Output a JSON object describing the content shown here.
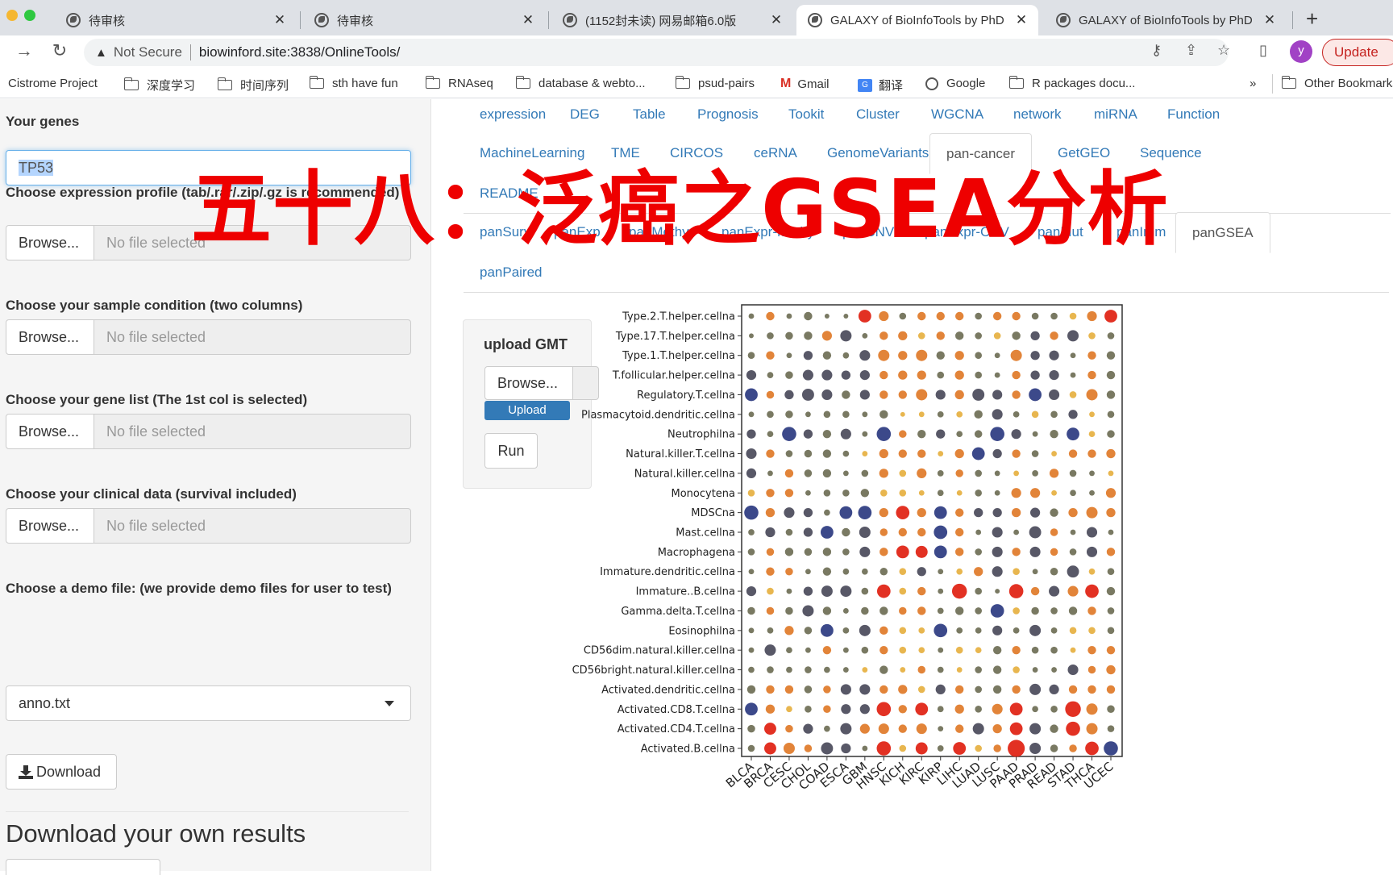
{
  "browser": {
    "tabs": [
      {
        "title": "待审核",
        "active": false
      },
      {
        "title": "待审核",
        "active": false
      },
      {
        "title": "(1152封未读) 网易邮箱6.0版",
        "active": false
      },
      {
        "title": "GALAXY of BioInfoTools by PhD",
        "active": true
      },
      {
        "title": "GALAXY of BioInfoTools by PhD",
        "active": false
      }
    ],
    "close_glyph": "✕",
    "new_tab_glyph": "+",
    "security_label": "Not Secure",
    "url": "biowinford.site:3838/OnlineTools/",
    "profile_initial": "y",
    "update_label": "Update",
    "bookmarks": [
      {
        "label": "Cistrome Project",
        "icon": "none"
      },
      {
        "label": "深度学习",
        "icon": "folder"
      },
      {
        "label": "时间序列",
        "icon": "folder"
      },
      {
        "label": "sth have fun",
        "icon": "folder"
      },
      {
        "label": "RNAseq",
        "icon": "folder"
      },
      {
        "label": "database & webto...",
        "icon": "folder"
      },
      {
        "label": "psud-pairs",
        "icon": "folder"
      },
      {
        "label": "Gmail",
        "icon": "gmail"
      },
      {
        "label": "翻译",
        "icon": "google-translate"
      },
      {
        "label": "Google",
        "icon": "globe"
      },
      {
        "label": "R packages docu...",
        "icon": "folder"
      }
    ],
    "bookmarks_overflow": "»",
    "other_bookmarks": "Other Bookmarks"
  },
  "sidebar": {
    "genes_label": "Your genes",
    "genes_value": "TP53",
    "expression_label": "Choose expression profile (tab/.rar/.zip/.gz is recommended)",
    "condition_label": "Choose your sample condition (two columns)",
    "genelist_label": "Choose your gene list (The 1st col is selected)",
    "clinical_label": "Choose your clinical data (survival included)",
    "browse_label": "Browse...",
    "no_file_label": "No file selected",
    "demo_label": "Choose a demo file: (we provide demo files for user to test)",
    "demo_selected": "anno.txt",
    "download_label": "Download",
    "own_results_heading": "Download your own results"
  },
  "main_nav": {
    "row1": [
      "expression",
      "DEG",
      "Table",
      "Prognosis",
      "Tookit",
      "Cluster",
      "WGCNA",
      "network",
      "miRNA",
      "Function"
    ],
    "row2": [
      "MachineLearning",
      "TME",
      "CIRCOS",
      "ceRNA",
      "GenomeVariants",
      "pan-cancer",
      "GetGEO",
      "Sequence"
    ],
    "row3": [
      "README"
    ],
    "active": "pan-cancer"
  },
  "sub_nav": {
    "row1": [
      "panSurv",
      "panExp",
      "panMethy",
      "panExpr-Methy",
      "panCNV",
      "panExpr-CNV",
      "panMut",
      "panImm",
      "panGSEA"
    ],
    "row2": [
      "panPaired"
    ],
    "active": "panGSEA"
  },
  "overlay_title": "五十八：泛癌之GSEA分析",
  "gmt_panel": {
    "title": "upload GMT",
    "browse_label": "Browse...",
    "upload_label": "Upload",
    "run_label": "Run"
  },
  "colors": {
    "link": "#337ab7",
    "neg_strong": "#2b3a80",
    "neg_mid": "#4a4a5a",
    "neutral": "#6e6e55",
    "pos_light": "#e6b040",
    "pos_mid": "#e07a28",
    "pos_strong": "#e02010"
  },
  "chart_data": {
    "type": "scatter",
    "subtype": "dot-matrix",
    "title": "",
    "xlabel": "",
    "ylabel": "",
    "encoding": "score in [-1,1]: sign = color (negative dark/blue, positive orange/red), |score| = dot size",
    "categories_x": [
      "BLCA",
      "BRCA",
      "CESC",
      "CHOL",
      "COAD",
      "ESCA",
      "GBM",
      "HNSC",
      "KICH",
      "KIRC",
      "KIRP",
      "LIHC",
      "LUAD",
      "LUSC",
      "PAAD",
      "PRAD",
      "READ",
      "STAD",
      "THCA",
      "UCEC"
    ],
    "categories_y": [
      "Type.2.T.helper.cellna",
      "Type.17.T.helper.cellna",
      "Type.1.T.helper.cellna",
      "T.follicular.helper.cellna",
      "Regulatory.T.cellna",
      "Plasmacytoid.dendritic.cellna",
      "Neutrophilna",
      "Natural.killer.T.cellna",
      "Natural.killer.cellna",
      "Monocytena",
      "MDSCna",
      "Mast.cellna",
      "Macrophagena",
      "Immature.dendritic.cellna",
      "Immature..B.cellna",
      "Gamma.delta.T.cellna",
      "Eosinophilna",
      "CD56dim.natural.killer.cellna",
      "CD56bright.natural.killer.cellna",
      "Activated.dendritic.cellna",
      "Activated.CD8.T.cellna",
      "Activated.CD4.T.cellna",
      "Activated.B.cellna"
    ],
    "values": [
      [
        -0.1,
        0.3,
        -0.1,
        -0.3,
        -0.05,
        -0.05,
        0.6,
        0.4,
        -0.2,
        0.3,
        0.3,
        0.3,
        -0.2,
        0.3,
        0.3,
        -0.2,
        -0.2,
        0.2,
        0.4,
        0.6
      ],
      [
        -0.05,
        -0.2,
        -0.25,
        -0.3,
        0.4,
        -0.5,
        -0.1,
        0.3,
        0.35,
        0.2,
        0.3,
        -0.3,
        -0.2,
        0.2,
        -0.3,
        -0.35,
        0.3,
        -0.5,
        0.2,
        -0.2
      ],
      [
        -0.2,
        0.3,
        -0.1,
        -0.35,
        -0.3,
        -0.15,
        -0.45,
        0.5,
        0.35,
        0.5,
        -0.3,
        0.35,
        -0.2,
        -0.1,
        0.5,
        -0.35,
        -0.4,
        -0.1,
        0.3,
        -0.3
      ],
      [
        -0.4,
        -0.15,
        -0.25,
        -0.45,
        -0.45,
        -0.35,
        -0.4,
        0.3,
        0.35,
        0.35,
        -0.2,
        0.35,
        -0.2,
        -0.1,
        0.3,
        -0.35,
        -0.4,
        -0.1,
        0.3,
        -0.3
      ],
      [
        -0.6,
        0.25,
        -0.35,
        -0.55,
        -0.45,
        -0.3,
        -0.4,
        0.3,
        0.3,
        0.5,
        -0.4,
        0.35,
        -0.55,
        -0.4,
        0.3,
        -0.6,
        -0.45,
        0.2,
        0.5,
        -0.3
      ],
      [
        -0.1,
        -0.2,
        -0.25,
        -0.1,
        -0.2,
        -0.2,
        -0.1,
        -0.3,
        0.05,
        0.1,
        -0.15,
        0.15,
        -0.3,
        -0.45,
        -0.15,
        0.2,
        -0.2,
        -0.35,
        0.1,
        -0.2
      ],
      [
        -0.35,
        -0.15,
        -0.7,
        -0.35,
        -0.3,
        -0.45,
        -0.1,
        -0.7,
        0.25,
        -0.3,
        -0.35,
        -0.15,
        -0.25,
        -0.7,
        -0.4,
        -0.1,
        -0.3,
        -0.6,
        0.15,
        -0.25
      ],
      [
        -0.45,
        0.3,
        -0.2,
        -0.25,
        -0.3,
        -0.15,
        0.1,
        0.35,
        0.3,
        0.3,
        0.1,
        0.35,
        -0.6,
        -0.35,
        0.3,
        -0.2,
        0.1,
        0.3,
        0.3,
        0.35
      ],
      [
        -0.4,
        -0.1,
        0.3,
        -0.25,
        -0.3,
        -0.1,
        -0.2,
        0.35,
        0.2,
        0.4,
        -0.15,
        0.25,
        -0.2,
        -0.1,
        0.1,
        -0.15,
        0.35,
        -0.2,
        -0.1,
        0.1
      ],
      [
        0.2,
        0.3,
        0.3,
        -0.1,
        -0.2,
        -0.2,
        -0.3,
        0.2,
        0.2,
        0.1,
        -0.15,
        0.1,
        -0.2,
        -0.1,
        0.4,
        0.4,
        0.1,
        -0.15,
        -0.1,
        0.4
      ],
      [
        -0.7,
        0.35,
        -0.45,
        -0.35,
        -0.15,
        -0.6,
        -0.65,
        0.35,
        0.65,
        0.35,
        -0.6,
        0.3,
        -0.35,
        -0.35,
        0.35,
        -0.4,
        -0.3,
        0.35,
        0.5,
        0.35
      ],
      [
        -0.15,
        -0.4,
        -0.2,
        -0.35,
        -0.6,
        -0.3,
        -0.5,
        0.25,
        0.3,
        0.3,
        -0.65,
        0.3,
        -0.1,
        -0.45,
        -0.1,
        -0.55,
        0.25,
        -0.1,
        -0.45,
        -0.1
      ],
      [
        -0.2,
        0.25,
        -0.3,
        -0.25,
        -0.3,
        -0.2,
        -0.45,
        0.3,
        0.6,
        0.55,
        -0.6,
        0.3,
        -0.2,
        -0.45,
        0.3,
        -0.45,
        0.25,
        -0.2,
        -0.45,
        0.3
      ],
      [
        -0.1,
        0.3,
        0.25,
        -0.1,
        -0.3,
        -0.15,
        -0.15,
        -0.25,
        0.2,
        -0.35,
        -0.1,
        0.15,
        0.35,
        -0.45,
        0.2,
        -0.1,
        -0.25,
        -0.55,
        0.15,
        -0.2
      ],
      [
        -0.4,
        0.2,
        -0.1,
        -0.35,
        -0.5,
        -0.5,
        -0.2,
        0.65,
        0.2,
        0.3,
        -0.1,
        0.75,
        -0.2,
        -0.05,
        0.7,
        0.3,
        -0.45,
        0.45,
        0.65,
        -0.3
      ],
      [
        -0.25,
        0.25,
        -0.25,
        -0.5,
        -0.3,
        -0.1,
        -0.25,
        -0.3,
        0.25,
        0.3,
        -0.15,
        -0.3,
        -0.2,
        -0.65,
        0.2,
        -0.25,
        -0.2,
        -0.3,
        0.3,
        -0.2
      ],
      [
        -0.1,
        -0.15,
        0.35,
        -0.25,
        -0.6,
        -0.15,
        -0.5,
        0.3,
        0.2,
        0.15,
        -0.65,
        -0.15,
        -0.15,
        -0.4,
        -0.15,
        -0.5,
        -0.15,
        0.2,
        0.2,
        -0.2
      ],
      [
        -0.1,
        -0.5,
        -0.15,
        -0.1,
        0.3,
        -0.1,
        -0.2,
        0.3,
        0.2,
        0.15,
        -0.1,
        0.2,
        0.15,
        -0.3,
        0.3,
        -0.2,
        -0.2,
        0.1,
        0.3,
        0.3
      ],
      [
        -0.15,
        -0.2,
        -0.15,
        -0.2,
        -0.15,
        -0.1,
        0.1,
        -0.3,
        0.1,
        0.25,
        -0.15,
        0.1,
        -0.2,
        -0.3,
        0.2,
        -0.1,
        -0.1,
        -0.45,
        0.25,
        0.35
      ],
      [
        -0.3,
        0.3,
        0.3,
        -0.25,
        0.25,
        -0.45,
        -0.45,
        0.3,
        0.35,
        0.2,
        -0.4,
        0.3,
        -0.2,
        -0.3,
        0.3,
        -0.5,
        -0.4,
        0.3,
        0.3,
        0.3
      ],
      [
        -0.6,
        0.35,
        0.15,
        -0.2,
        0.25,
        -0.4,
        -0.4,
        0.7,
        0.3,
        0.6,
        -0.15,
        0.35,
        -0.2,
        0.45,
        0.6,
        -0.15,
        -0.2,
        0.8,
        0.5,
        -0.25
      ],
      [
        -0.25,
        0.55,
        0.25,
        -0.4,
        -0.15,
        -0.5,
        0.4,
        0.45,
        0.3,
        0.45,
        -0.1,
        0.3,
        -0.5,
        0.35,
        0.6,
        -0.5,
        -0.3,
        0.7,
        0.5,
        -0.2
      ],
      [
        -0.2,
        0.55,
        0.5,
        0.25,
        -0.55,
        -0.4,
        -0.1,
        0.7,
        0.2,
        0.55,
        -0.15,
        0.6,
        0.2,
        0.25,
        0.9,
        -0.5,
        -0.25,
        0.25,
        0.65,
        -0.7
      ]
    ]
  }
}
